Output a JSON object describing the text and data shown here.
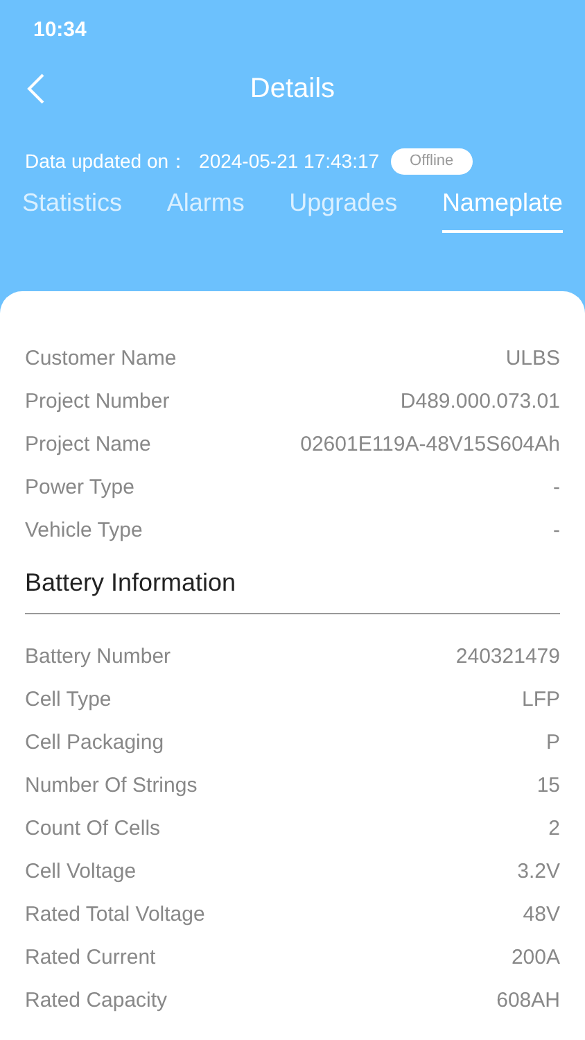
{
  "status_bar": {
    "time": "10:34"
  },
  "header": {
    "title": "Details",
    "updated_label": "Data updated on：",
    "updated_value": "2024-05-21 17:43:17",
    "status_badge": "Offline"
  },
  "tabs": [
    {
      "label": "Statistics",
      "selected": false
    },
    {
      "label": "Alarms",
      "selected": false
    },
    {
      "label": "Upgrades",
      "selected": false
    },
    {
      "label": "Nameplate",
      "selected": true
    }
  ],
  "general": [
    {
      "label": "Customer Name",
      "value": "ULBS"
    },
    {
      "label": "Project Number",
      "value": "D489.000.073.01"
    },
    {
      "label": "Project Name",
      "value": "02601E119A-48V15S604Ah"
    },
    {
      "label": "Power Type",
      "value": "-"
    },
    {
      "label": "Vehicle Type",
      "value": "-"
    }
  ],
  "battery_section": {
    "title": "Battery Information",
    "rows": [
      {
        "label": "Battery Number",
        "value": "240321479"
      },
      {
        "label": "Cell Type",
        "value": "LFP"
      },
      {
        "label": "Cell Packaging",
        "value": "P"
      },
      {
        "label": "Number Of Strings",
        "value": "15"
      },
      {
        "label": "Count Of Cells",
        "value": "2"
      },
      {
        "label": "Cell Voltage",
        "value": "3.2V"
      },
      {
        "label": "Rated Total Voltage",
        "value": "48V"
      },
      {
        "label": "Rated Current",
        "value": "200A"
      },
      {
        "label": "Rated Capacity",
        "value": "608AH"
      }
    ]
  }
}
